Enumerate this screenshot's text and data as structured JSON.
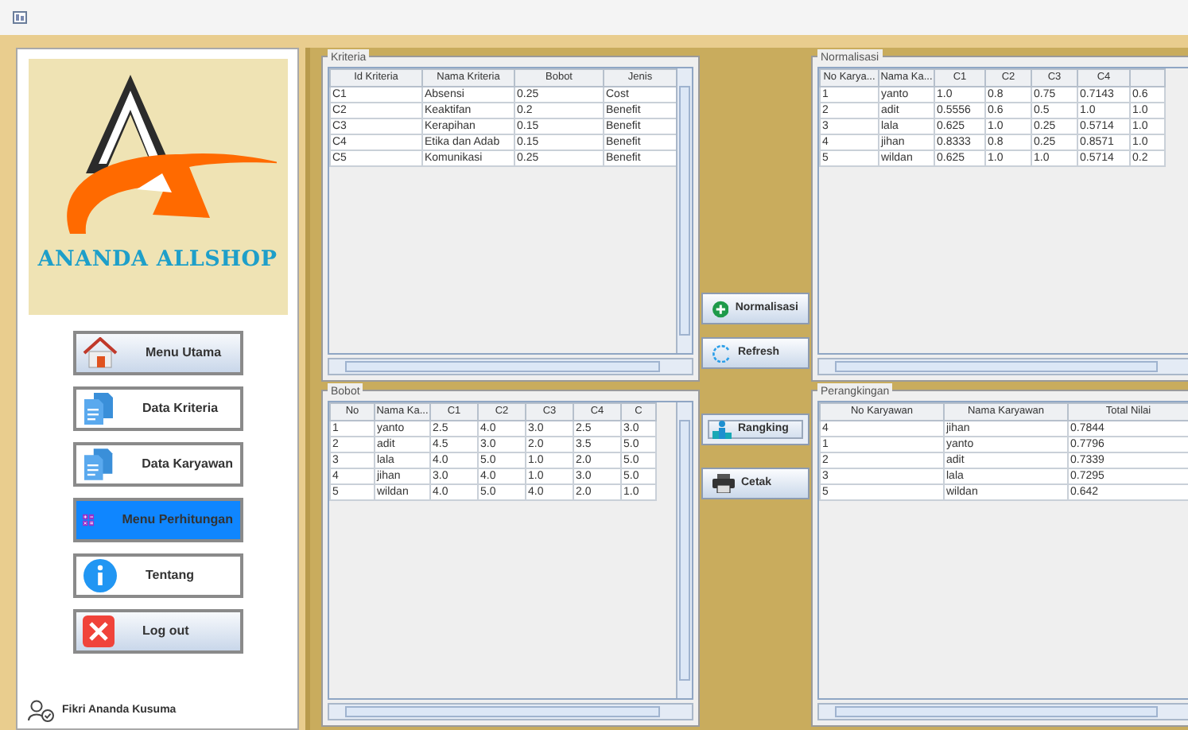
{
  "sidebar": {
    "logo_text": "ANANDA ALLSHOP",
    "menu": [
      {
        "label": "Menu Utama",
        "kind": "home",
        "raised": true,
        "selected": false
      },
      {
        "label": "Data Kriteria",
        "kind": "document",
        "raised": false,
        "selected": false
      },
      {
        "label": "Data Karyawan",
        "kind": "document",
        "raised": false,
        "selected": false
      },
      {
        "label": "Menu Perhitungan",
        "kind": "calculator",
        "raised": false,
        "selected": true
      },
      {
        "label": "Tentang",
        "kind": "info",
        "raised": false,
        "selected": false
      },
      {
        "label": "Log out",
        "kind": "close",
        "raised": true,
        "selected": false
      }
    ],
    "user": "Fikri Ananda Kusuma"
  },
  "panels": [
    {
      "title": "Kriteria",
      "vscroll": true,
      "columns": [
        "Id Kriteria",
        "Nama Kriteria",
        "Bobot",
        "Jenis"
      ],
      "rows": [
        [
          "C1",
          "Absensi",
          "0.25",
          "Cost"
        ],
        [
          "C2",
          "Keaktifan",
          "0.2",
          "Benefit"
        ],
        [
          "C3",
          "Kerapihan",
          "0.15",
          "Benefit"
        ],
        [
          "C4",
          "Etika dan Adab",
          "0.15",
          "Benefit"
        ],
        [
          "C5",
          "Komunikasi",
          "0.25",
          "Benefit"
        ]
      ]
    },
    {
      "title": "Normalisasi",
      "vscroll": false,
      "columns": [
        "No Karya...",
        "Nama Ka...",
        "C1",
        "C2",
        "C3",
        "C4"
      ],
      "rows": [
        [
          "1",
          "yanto",
          "1.0",
          "0.8",
          "0.75",
          "0.7143",
          "0.6"
        ],
        [
          "2",
          "adit",
          "0.5556",
          "0.6",
          "0.5",
          "1.0",
          "1.0"
        ],
        [
          "3",
          "lala",
          "0.625",
          "1.0",
          "0.25",
          "0.5714",
          "1.0"
        ],
        [
          "4",
          "jihan",
          "0.8333",
          "0.8",
          "0.25",
          "0.8571",
          "1.0"
        ],
        [
          "5",
          "wildan",
          "0.625",
          "1.0",
          "1.0",
          "0.5714",
          "0.2"
        ]
      ]
    },
    {
      "title": "Bobot",
      "vscroll": true,
      "columns": [
        "No",
        "Nama Ka...",
        "C1",
        "C2",
        "C3",
        "C4",
        "C"
      ],
      "rows": [
        [
          "1",
          "yanto",
          "2.5",
          "4.0",
          "3.0",
          "2.5",
          "3.0"
        ],
        [
          "2",
          "adit",
          "4.5",
          "3.0",
          "2.0",
          "3.5",
          "5.0"
        ],
        [
          "3",
          "lala",
          "4.0",
          "5.0",
          "1.0",
          "2.0",
          "5.0"
        ],
        [
          "4",
          "jihan",
          "3.0",
          "4.0",
          "1.0",
          "3.0",
          "5.0"
        ],
        [
          "5",
          "wildan",
          "4.0",
          "5.0",
          "4.0",
          "2.0",
          "1.0"
        ]
      ]
    },
    {
      "title": "Perangkingan",
      "vscroll": false,
      "columns": [
        "No Karyawan",
        "Nama Karyawan",
        "Total Nilai"
      ],
      "rows": [
        [
          "4",
          "jihan",
          "0.7844"
        ],
        [
          "1",
          "yanto",
          "0.7796"
        ],
        [
          "2",
          "adit",
          "0.7339"
        ],
        [
          "3",
          "lala",
          "0.7295"
        ],
        [
          "5",
          "wildan",
          "0.642"
        ]
      ]
    }
  ],
  "actions": [
    [
      {
        "label": "Normalisasi",
        "kind": "plus",
        "focused": false
      },
      {
        "label": "Refresh",
        "kind": "refresh",
        "focused": false
      }
    ],
    [
      {
        "label": "Rangking",
        "kind": "rank",
        "focused": true
      },
      {
        "label": "Cetak",
        "kind": "printer",
        "focused": false
      }
    ]
  ]
}
